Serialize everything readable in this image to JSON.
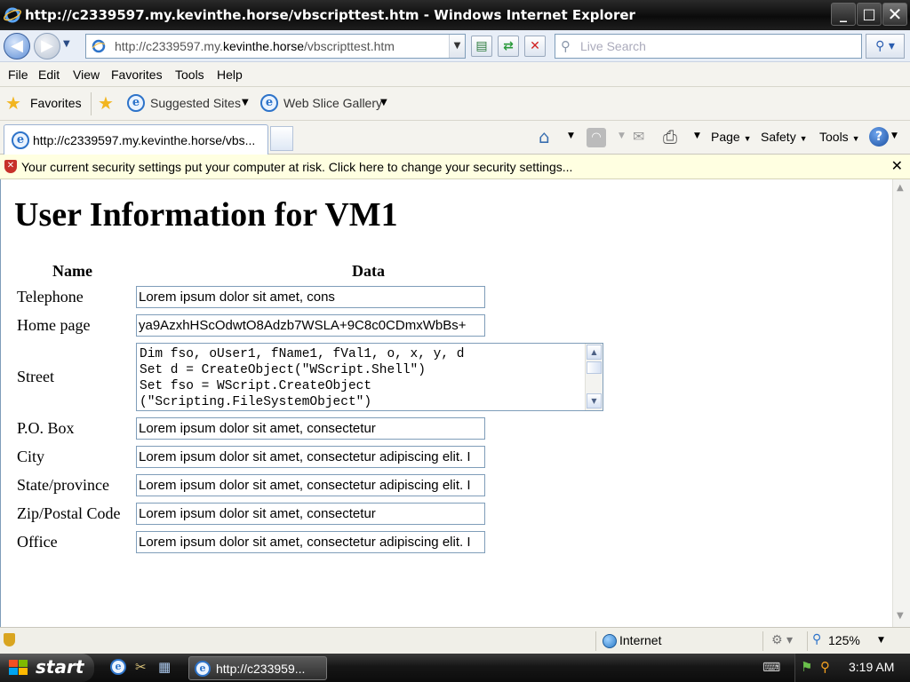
{
  "window": {
    "title": "http://c2339597.my.kevinthe.horse/vbscripttest.htm - Windows Internet Explorer",
    "minimize_label": "_",
    "maximize_label": "□",
    "close_label": "✕"
  },
  "address_bar": {
    "url_prefix": "http://c2339597.my.",
    "url_domain": "kevinthe.horse",
    "url_suffix": "/vbscripttest.htm",
    "search_placeholder": "Live Search"
  },
  "menu": [
    "File",
    "Edit",
    "View",
    "Favorites",
    "Tools",
    "Help"
  ],
  "favorites_bar": {
    "favorites_label": "Favorites",
    "suggested_sites": "Suggested Sites",
    "web_slice_gallery": "Web Slice Gallery"
  },
  "tabs": {
    "active_tab_label": "http://c2339597.my.kevinthe.horse/vbs..."
  },
  "command_bar": {
    "page": "Page",
    "safety": "Safety",
    "tools": "Tools"
  },
  "info_bar": {
    "message": "Your current security settings put your computer at risk. Click here to change your security settings..."
  },
  "page": {
    "title": "User Information for VM1",
    "header_name": "Name",
    "header_data": "Data",
    "fields": [
      {
        "label": "Telephone",
        "value": "Lorem ipsum dolor sit amet, cons"
      },
      {
        "label": "Home page",
        "value": "ya9AzxhHScOdwtO8Adzb7WSLA+9C8c0CDmxWbBs+"
      },
      {
        "label": "Street",
        "value": "Dim fso, oUser1, fName1, fVal1, o, x, y, d\nSet d = CreateObject(\"WScript.Shell\")\nSet fso = WScript.CreateObject\n(\"Scripting.FileSystemObject\")"
      },
      {
        "label": "P.O. Box",
        "value": "Lorem ipsum dolor sit amet, consectetur"
      },
      {
        "label": "City",
        "value": "Lorem ipsum dolor sit amet, consectetur adipiscing elit. I"
      },
      {
        "label": "State/province",
        "value": "Lorem ipsum dolor sit amet, consectetur adipiscing elit. I"
      },
      {
        "label": "Zip/Postal Code",
        "value": "Lorem ipsum dolor sit amet, consectetur"
      },
      {
        "label": "Office",
        "value": "Lorem ipsum dolor sit amet, consectetur adipiscing elit. I"
      }
    ]
  },
  "status_bar": {
    "zone": "Internet",
    "zoom": "125%"
  },
  "taskbar": {
    "start_label": "start",
    "task_label": "http://c233959...",
    "clock": "3:19 AM"
  }
}
